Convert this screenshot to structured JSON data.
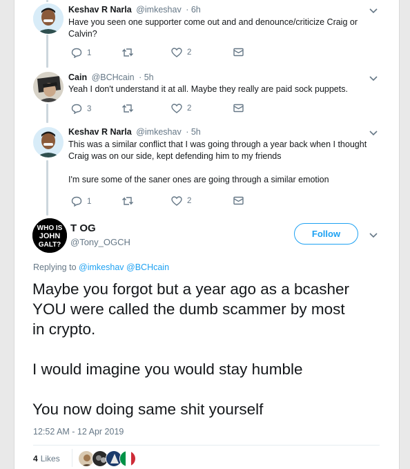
{
  "replies": [
    {
      "name": "Keshav R Narla",
      "handle": "@imkeshav",
      "time": "· 6h",
      "text_lines": [
        "Have you seen one supporter come out and and denounce/criticize Craig or",
        "Calvin?"
      ],
      "replies_count": "1",
      "likes_count": "2"
    },
    {
      "name": "Cain",
      "handle": "@BCHcain",
      "time": "· 5h",
      "text_lines": [
        "Yeah I don't understand it at all. Maybe they really are paid sock puppets."
      ],
      "replies_count": "3",
      "likes_count": "2"
    },
    {
      "name": "Keshav R Narla",
      "handle": "@imkeshav",
      "time": "· 5h",
      "text_lines": [
        "This was a similar conflict that I was going through a year back when I thought",
        "Craig was on our side, kept defending him to my friends"
      ],
      "text_para2": "I'm sure some of the saner ones are going through a similar emotion",
      "replies_count": "1",
      "likes_count": "2"
    }
  ],
  "main_tweet": {
    "avatar_text": [
      "WHO IS",
      "JOHN",
      "GALT?"
    ],
    "name": "T OG",
    "handle": "@Tony_OGCH",
    "follow_label": "Follow",
    "replying_prefix": "Replying to",
    "replying_to": [
      "@imkeshav",
      "@BCHcain"
    ],
    "paragraphs": [
      [
        "Maybe you forgot but a year ago as a bcasher",
        "YOU were called the dumb scammer by most",
        "in crypto."
      ],
      [
        "I would imagine you would stay humble"
      ],
      [
        "You now doing same shit yourself"
      ]
    ],
    "timestamp": "12:52 AM - 12 Apr 2019",
    "likes_count": "4",
    "likes_label": "Likes"
  },
  "icons": {
    "reply": "reply-bubble-icon",
    "retweet": "retweet-icon",
    "like": "heart-icon",
    "dm": "envelope-icon",
    "caret": "chevron-down-icon"
  },
  "colors": {
    "accent": "#1da1f2",
    "muted": "#657786",
    "thread_line": "#ccd6dd"
  }
}
